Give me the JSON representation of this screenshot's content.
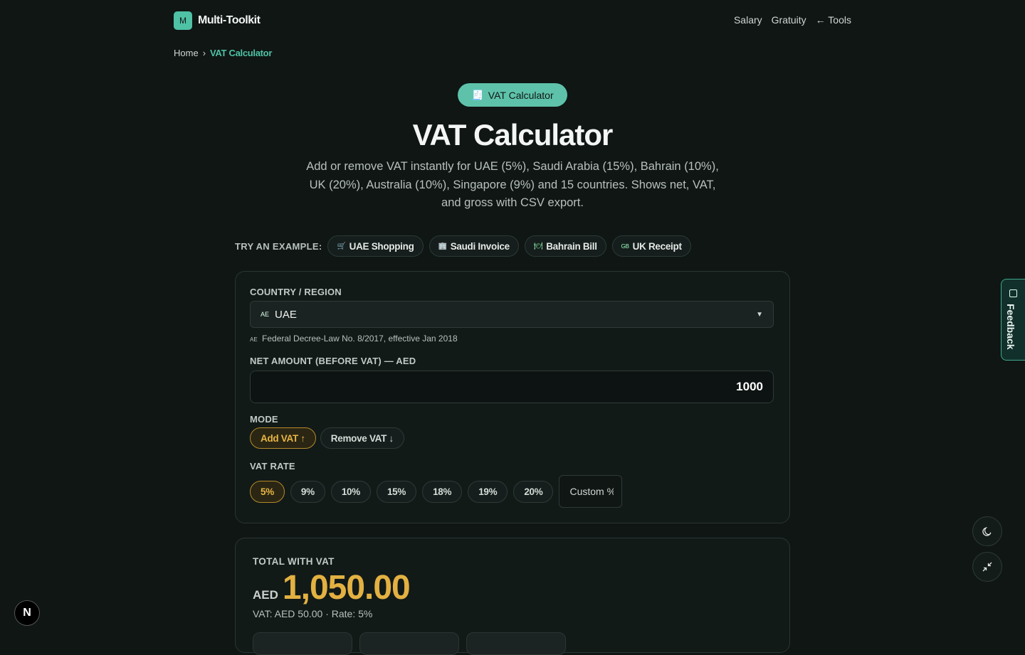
{
  "header": {
    "logo_letter": "M",
    "logo_text": "Multi-Toolkit",
    "nav": [
      "Salary",
      "Gratuity",
      "← Tools"
    ]
  },
  "breadcrumb": {
    "home": "Home",
    "separator": "›",
    "current": "VAT Calculator"
  },
  "hero": {
    "pill_icon": "🧾",
    "pill_label": "VAT Calculator",
    "title": "VAT Calculator",
    "subtitle": "Add or remove VAT instantly for UAE (5%), Saudi Arabia (15%), Bahrain (10%), UK (20%), Australia (10%), Singapore (9%) and 15 countries. Shows net, VAT, and gross with CSV export."
  },
  "examples": {
    "label": "TRY AN EXAMPLE:",
    "items": [
      {
        "icon": "🛒",
        "label": "UAE Shopping"
      },
      {
        "icon": "🏢",
        "label": "Saudi Invoice"
      },
      {
        "icon": "🍽",
        "label": "Bahrain Bill"
      },
      {
        "icon": "GB",
        "label": "UK Receipt"
      }
    ]
  },
  "form": {
    "country_label": "COUNTRY / REGION",
    "country_flag": "AE",
    "country_value": "UAE",
    "caret": "▼",
    "country_hint_flag": "AE",
    "country_hint": "Federal Decree-Law No. 8/2017, effective Jan 2018",
    "amount_label": "NET AMOUNT (BEFORE VAT) — AED",
    "amount_value": "1000",
    "mode_label": "MODE",
    "mode_add": "Add VAT ↑",
    "mode_remove": "Remove VAT ↓",
    "rate_label": "VAT RATE",
    "rates": [
      "5%",
      "9%",
      "10%",
      "15%",
      "18%",
      "19%",
      "20%"
    ],
    "custom_placeholder": "Custom %"
  },
  "result": {
    "label": "TOTAL WITH VAT",
    "currency": "AED",
    "amount": "1,050.00",
    "sub": "VAT: AED 50.00 · Rate: 5%"
  },
  "feedback_label": "Feedback",
  "next_badge": "N",
  "colors": {
    "accent": "#4fc1a5",
    "highlight": "#e3b142",
    "background": "#0f1614"
  }
}
